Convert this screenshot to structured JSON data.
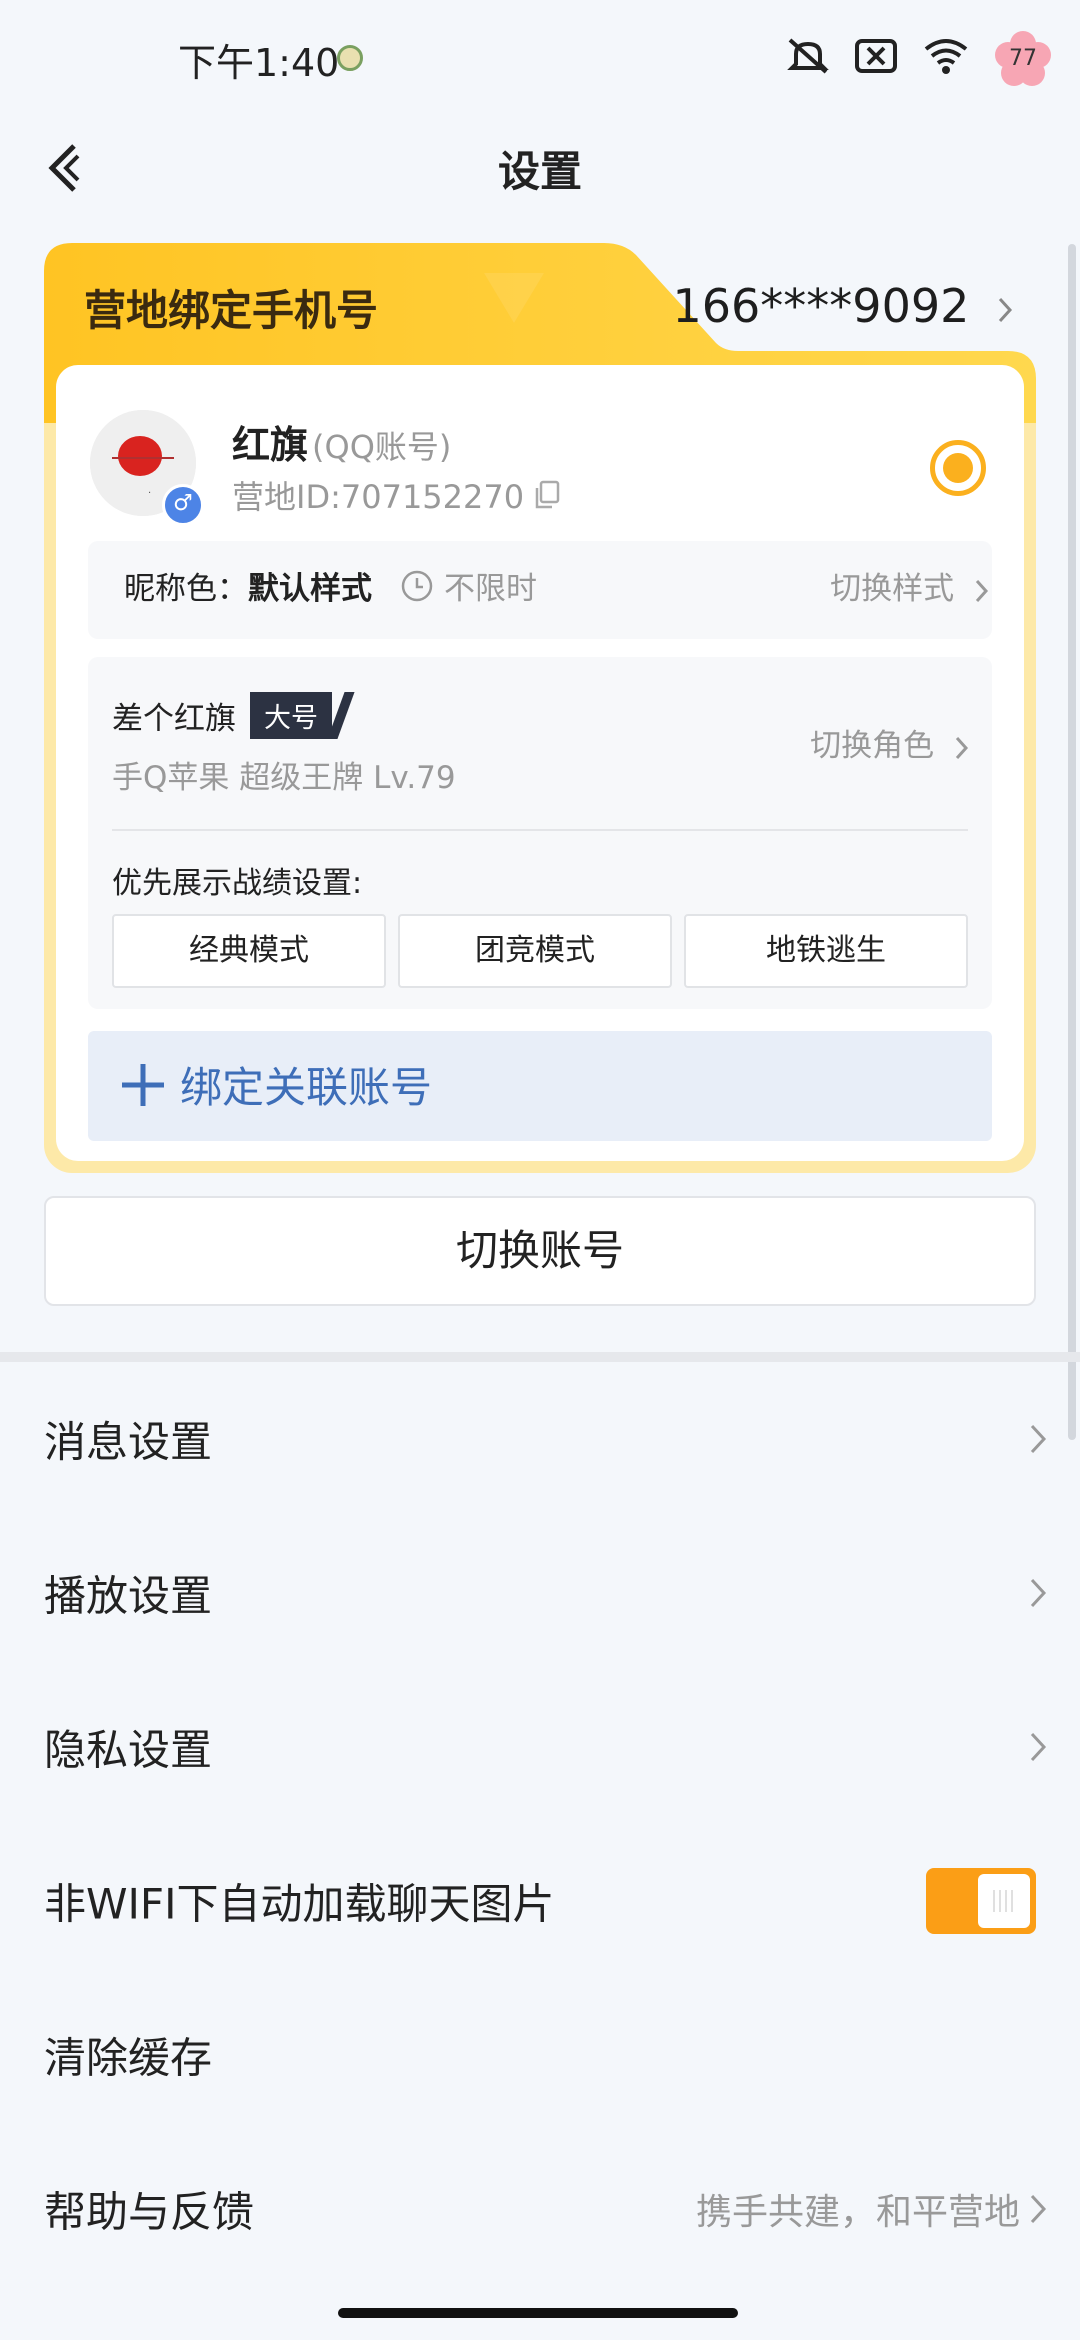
{
  "status": {
    "time": "下午1:40",
    "battery": "77",
    "icons": [
      "mute-icon",
      "data-off-icon",
      "wifi-icon"
    ]
  },
  "header": {
    "title": "设置",
    "back_icon": "back-icon"
  },
  "card": {
    "phone_label": "营地绑定手机号",
    "phone": "166****9092",
    "user": {
      "name": "红旗",
      "account_type": "(QQ账号)",
      "camp_id": "营地ID:707152270",
      "gender": "♂"
    },
    "nickname": {
      "label": "昵称色：",
      "value": "默认样式",
      "time": "不限时",
      "switch_label": "切换样式"
    },
    "role": {
      "name": "差个红旗",
      "badge": "大号",
      "sub": "手Q苹果   超级王牌   Lv.79",
      "switch_label": "切换角色"
    },
    "priority_label": "优先展示战绩设置:",
    "modes": [
      "经典模式",
      "团竞模式",
      "地铁逃生"
    ],
    "bind_label": "绑定关联账号"
  },
  "switch_account_label": "切换账号",
  "settings": [
    {
      "label": "消息设置",
      "right": "",
      "chevron": true
    },
    {
      "label": "播放设置",
      "right": "",
      "chevron": true
    },
    {
      "label": "隐私设置",
      "right": "",
      "chevron": true
    },
    {
      "label": "非WIFI下自动加载聊天图片",
      "right": "",
      "chevron": false,
      "toggle_on": true
    },
    {
      "label": "清除缓存",
      "right": "",
      "chevron": false
    },
    {
      "label": "帮助与反馈",
      "right": "携手共建，和平营地",
      "chevron": true
    }
  ],
  "colors": {
    "accent": "#fbb01e",
    "toggle": "#fb9e16",
    "bind_text": "#3e6eb8"
  }
}
